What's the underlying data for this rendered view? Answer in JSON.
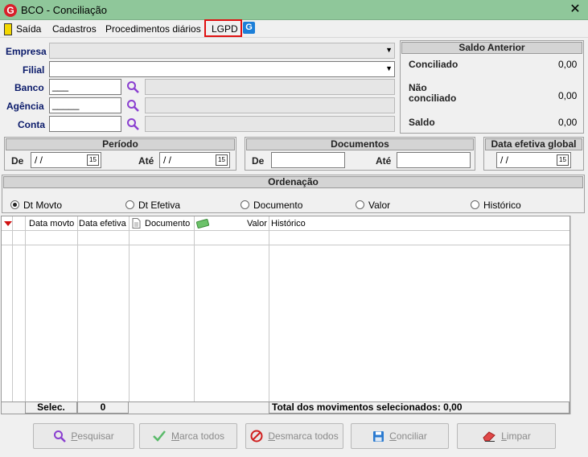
{
  "window": {
    "title": "BCO - Conciliação",
    "app_icon_letter": "G",
    "close_glyph": "✕"
  },
  "menu": {
    "items": [
      "Saída",
      "Cadastros",
      "Procedimentos diários",
      "LGPD"
    ]
  },
  "form": {
    "empresa_label": "Empresa",
    "filial_label": "Filial",
    "banco_label": "Banco",
    "banco_value": "___",
    "agencia_label": "Agência",
    "agencia_value": "_____",
    "conta_label": "Conta"
  },
  "saldo": {
    "title": "Saldo Anterior",
    "conciliado_label": "Conciliado",
    "conciliado_value": "0,00",
    "nao_label_1": "Não",
    "nao_label_2": "conciliado",
    "nao_value": "0,00",
    "saldo_label": "Saldo",
    "saldo_value": "0,00"
  },
  "periodo": {
    "title": "Período",
    "de_label": "De",
    "de_value": "/ /",
    "ate_label": "Até",
    "ate_value": "/ /",
    "cal": "15"
  },
  "documentos": {
    "title": "Documentos",
    "de_label": "De",
    "ate_label": "Até"
  },
  "data_efetiva": {
    "title": "Data efetiva global",
    "value": "/ /",
    "cal": "15"
  },
  "ordenacao": {
    "title": "Ordenação",
    "options": [
      "Dt Movto",
      "Dt Efetiva",
      "Documento",
      "Valor",
      "Histórico"
    ],
    "selected": "Dt Movto"
  },
  "grid": {
    "columns": [
      "Data movto",
      "Data efetiva",
      "Documento",
      "Valor",
      "Histórico"
    ],
    "footer_selec_label": "Selec.",
    "footer_selec_value": "0",
    "footer_total": "Total dos movimentos selecionados: 0,00"
  },
  "buttons": {
    "pesquisar": "Pesquisar",
    "marca_todos": "Marca todos",
    "desmarca_todos": "Desmarca todos",
    "conciliar": "Conciliar",
    "limpar": "Limpar"
  },
  "colors": {
    "titlebar": "#8fc79a",
    "label": "#0a1a6a",
    "lgpd_highlight": "#e01010",
    "search_icon": "#8a3fd0"
  }
}
